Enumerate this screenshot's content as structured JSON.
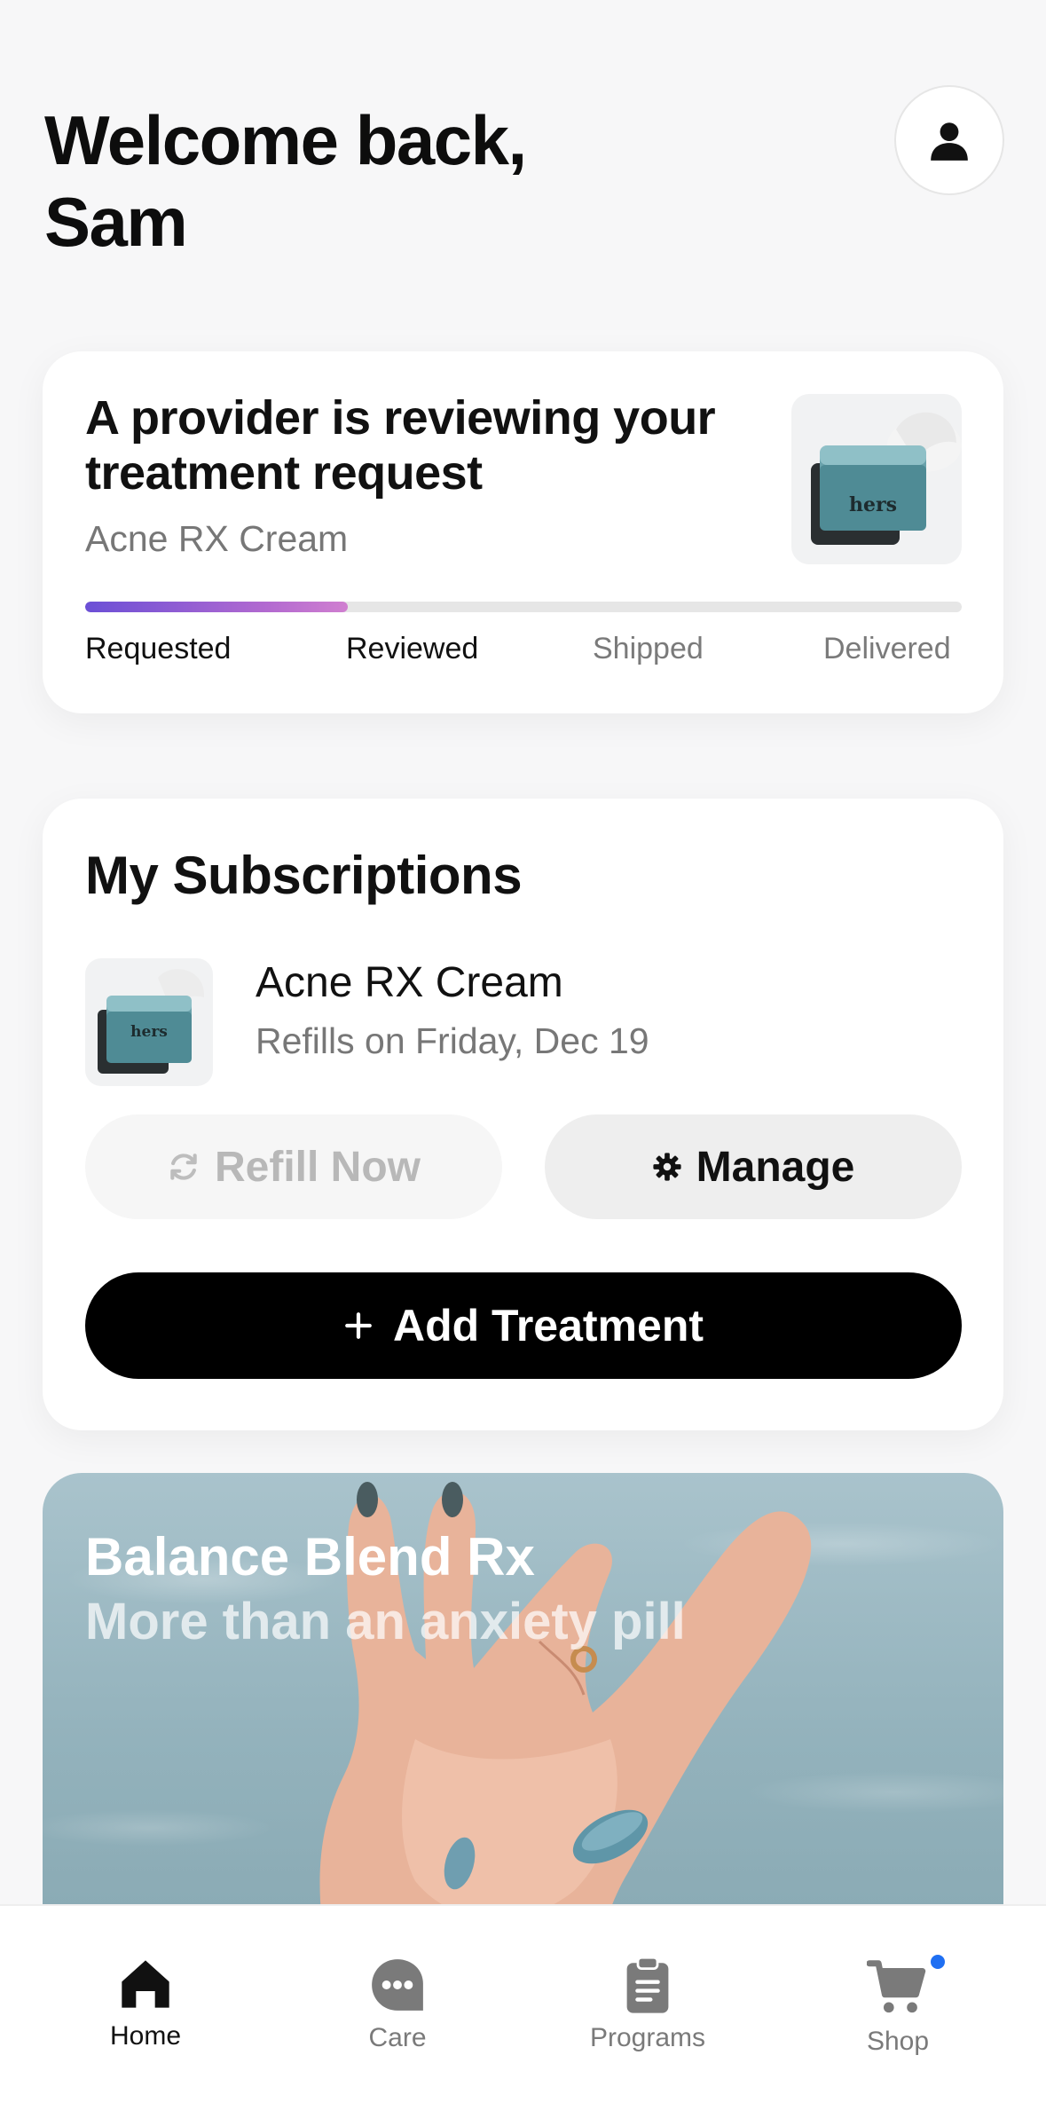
{
  "header": {
    "greeting_line1": "Welcome back,",
    "greeting_line2": "Sam",
    "profile_icon": "person-icon"
  },
  "status_card": {
    "title": "A provider is reviewing your treatment request",
    "product": "Acne RX Cream",
    "progress_fraction": 0.3,
    "steps": [
      {
        "label": "Requested",
        "state": "done"
      },
      {
        "label": "Reviewed",
        "state": "done"
      },
      {
        "label": "Shipped",
        "state": "todo"
      },
      {
        "label": "Delivered",
        "state": "todo"
      }
    ],
    "progress_colors": [
      "#6b4fd6",
      "#d07fd0"
    ]
  },
  "subscriptions": {
    "title": "My Subscriptions",
    "item": {
      "name": "Acne RX Cream",
      "refill_text": "Refills on Friday, Dec 19"
    },
    "refill_button": "Refill Now",
    "manage_button": "Manage",
    "add_button": "Add Treatment"
  },
  "promo": {
    "title": "Balance Blend Rx",
    "subtitle": "More than an anxiety pill"
  },
  "tabbar": {
    "tabs": [
      {
        "label": "Home",
        "icon": "home-icon",
        "active": true
      },
      {
        "label": "Care",
        "icon": "chat-icon",
        "active": false
      },
      {
        "label": "Programs",
        "icon": "clipboard-icon",
        "active": false
      },
      {
        "label": "Shop",
        "icon": "cart-icon",
        "active": false
      }
    ],
    "notification_color": "#1f6ff2"
  }
}
